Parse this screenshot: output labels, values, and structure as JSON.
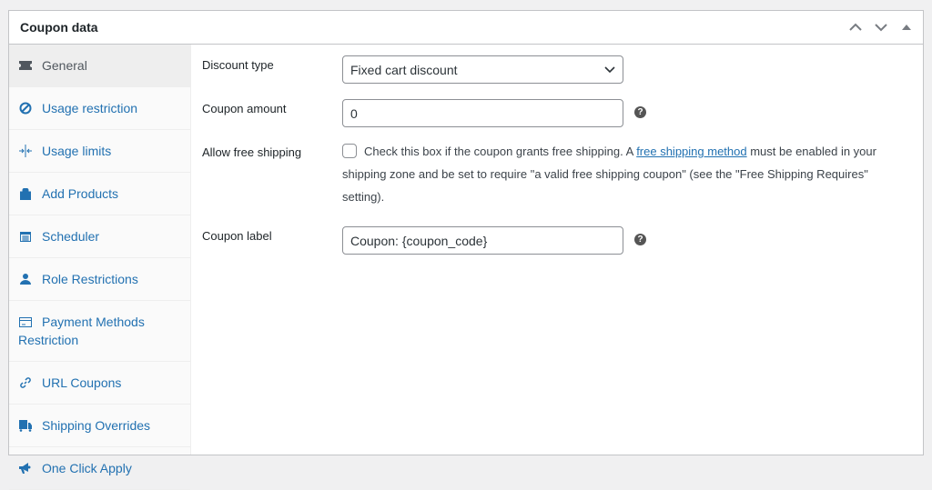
{
  "header": {
    "title": "Coupon data"
  },
  "sidebar": {
    "items": [
      {
        "label": "General",
        "icon": "ticket-icon"
      },
      {
        "label": "Usage restriction",
        "icon": "block-icon"
      },
      {
        "label": "Usage limits",
        "icon": "limits-icon"
      },
      {
        "label": "Add Products",
        "icon": "bag-icon"
      },
      {
        "label": "Scheduler",
        "icon": "calendar-icon"
      },
      {
        "label": "Role Restrictions",
        "icon": "user-icon"
      },
      {
        "label": "Payment Methods Restriction",
        "icon": "card-icon"
      },
      {
        "label": "URL Coupons",
        "icon": "link-icon"
      },
      {
        "label": "Shipping Overrides",
        "icon": "truck-icon"
      },
      {
        "label": "One Click Apply",
        "icon": "megaphone-icon"
      }
    ]
  },
  "form": {
    "discount_type": {
      "label": "Discount type",
      "value": "Fixed cart discount"
    },
    "coupon_amount": {
      "label": "Coupon amount",
      "value": "0"
    },
    "free_shipping": {
      "label": "Allow free shipping",
      "text_before": "Check this box if the coupon grants free shipping. A ",
      "link": "free shipping method",
      "text_after": " must be enabled in your shipping zone and be set to require \"a valid free shipping coupon\" (see the \"Free Shipping Requires\" setting).",
      "checked": false
    },
    "coupon_label": {
      "label": "Coupon label",
      "value": "Coupon: {coupon_code}"
    }
  },
  "colors": {
    "accent": "#2271b1"
  }
}
